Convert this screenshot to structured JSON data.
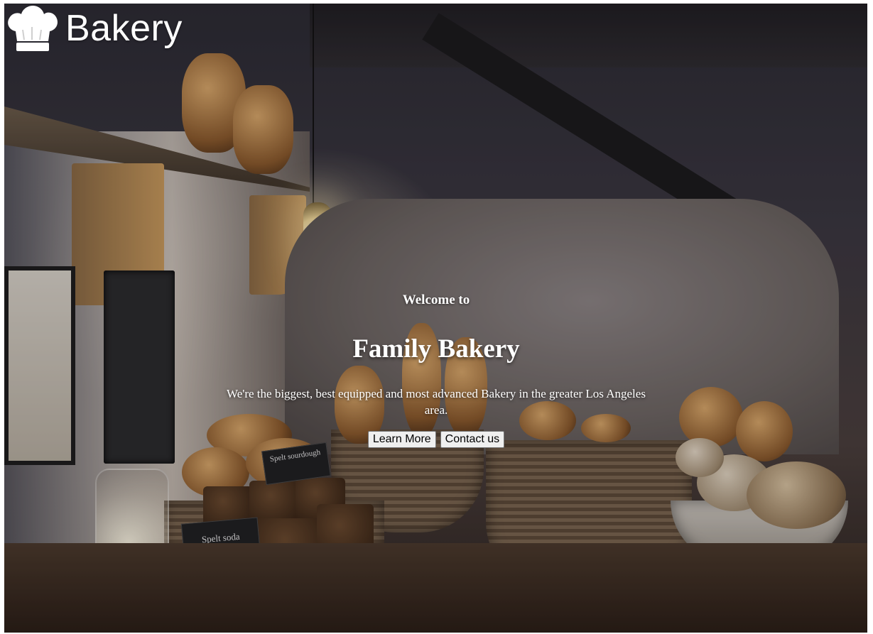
{
  "brand": {
    "name": "Bakery",
    "icon": "chef-hat-icon"
  },
  "hero": {
    "eyebrow": "Welcome to",
    "title": "Family Bakery",
    "description": "We're the biggest, best equipped and most advanced Bakery in the greater Los Angeles area.",
    "buttons": {
      "learn_more": "Learn More",
      "contact_us": "Contact us"
    }
  },
  "background": {
    "signs": [
      "Spelt sourdough",
      "Spelt soda"
    ]
  }
}
